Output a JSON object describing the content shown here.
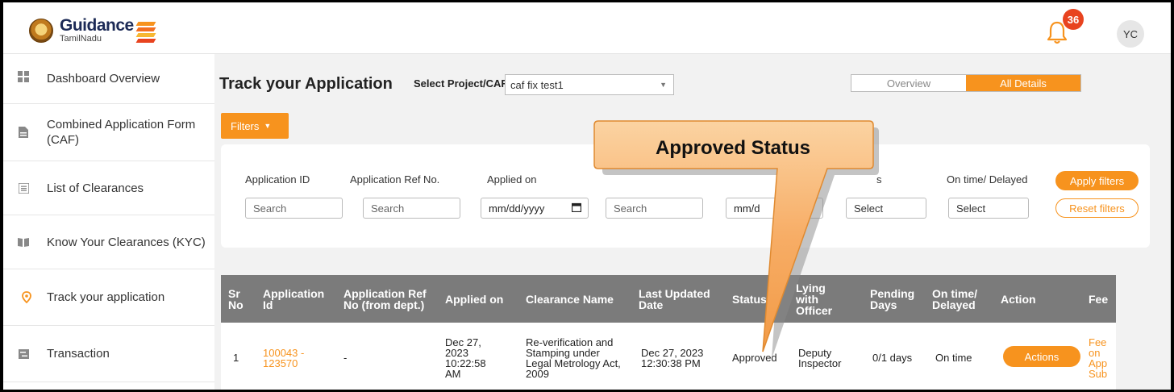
{
  "header": {
    "logo_main": "Guidance",
    "logo_sub": "TamilNadu",
    "notification_count": "36",
    "avatar_initials": "YC"
  },
  "sidebar": {
    "items": [
      {
        "label": "Dashboard Overview",
        "icon": "grid-icon"
      },
      {
        "label": "Combined Application Form (CAF)",
        "icon": "document-icon"
      },
      {
        "label": "List of Clearances",
        "icon": "list-icon"
      },
      {
        "label": "Know Your Clearances (KYC)",
        "icon": "book-icon"
      },
      {
        "label": "Track your application",
        "icon": "location-pin-icon"
      },
      {
        "label": "Transaction",
        "icon": "transaction-icon"
      }
    ]
  },
  "main": {
    "title": "Track your Application",
    "select_label": "Select Project/CAF",
    "select_value": "caf fix test1",
    "view_toggle": {
      "overview": "Overview",
      "all_details": "All Details"
    },
    "filters_button": "Filters",
    "filters": {
      "application_id_label": "Application ID",
      "application_ref_label": "Application Ref No.",
      "applied_on_label": "Applied on",
      "on_time_label": "On time/ Delayed",
      "status_label_fragment": "s",
      "search_placeholder": "Search",
      "date_placeholder": "mm/dd/yyyy",
      "date_placeholder_partial": "mm/d",
      "select_placeholder": "Select",
      "apply_button": "Apply filters",
      "reset_button": "Reset filters"
    },
    "table": {
      "headers": [
        "Sr No",
        "Application Id",
        "Application Ref No (from dept.)",
        "Applied on",
        "Clearance Name",
        "Last Updated Date",
        "Status",
        "Lying with Officer",
        "Pending Days",
        "On time/ Delayed",
        "Action",
        "Fee"
      ],
      "rows": [
        {
          "sr": "1",
          "application_id": "100043 - 123570",
          "ref_no": "-",
          "applied_on": "Dec 27, 2023 10:22:58 AM",
          "clearance_name": "Re-verification and Stamping under Legal Metrology Act, 2009",
          "last_updated": "Dec 27, 2023 12:30:38 PM",
          "status": "Approved",
          "lying_with": "Deputy Inspector",
          "pending_days": "0/1 days",
          "on_time": "On time",
          "action_button": "Actions",
          "fee_link": "Fee on App Sub"
        }
      ]
    }
  },
  "callout": {
    "text": "Approved Status"
  },
  "colors": {
    "accent": "#f7931e",
    "header_gray": "#7b7b7b",
    "badge_red": "#e8431f"
  }
}
